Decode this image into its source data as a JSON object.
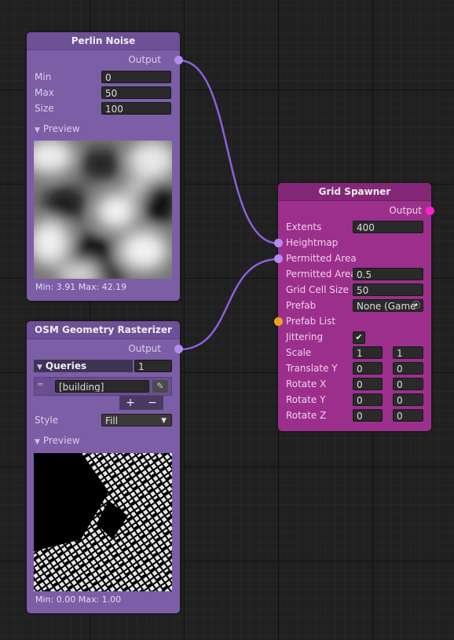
{
  "edge_color": "#8e5fd9",
  "perlin": {
    "title": "Perlin Noise",
    "output_label": "Output",
    "fields": [
      {
        "label": "Min",
        "value": "0"
      },
      {
        "label": "Max",
        "value": "50"
      },
      {
        "label": "Size",
        "value": "100"
      }
    ],
    "preview_label": "Preview",
    "minmax": "Min: 3.91 Max: 42.19"
  },
  "osm": {
    "title": "OSM Geometry Rasterizer",
    "output_label": "Output",
    "queries_label": "Queries",
    "queries_count": "1",
    "query_item": "[building]",
    "add_label": "+",
    "remove_label": "−",
    "style_label": "Style",
    "style_value": "Fill",
    "preview_label": "Preview",
    "minmax": "Min: 0.00 Max: 1.00"
  },
  "grid": {
    "title": "Grid Spawner",
    "output_label": "Output",
    "extents_label": "Extents",
    "extents_value": "400",
    "heightmap_label": "Heightmap",
    "permitted_area_input_label": "Permitted Area",
    "permitted_area_label": "Permitted Area",
    "permitted_area_value": "0.5",
    "grid_cell_size_label": "Grid Cell Size",
    "grid_cell_size_value": "50",
    "prefab_label": "Prefab",
    "prefab_value": "None (Game",
    "prefab_list_label": "Prefab List",
    "jittering_label": "Jittering",
    "jittering_check": "✔",
    "scale_label": "Scale",
    "scale_values": [
      "1",
      "1"
    ],
    "translate_y_label": "Translate Y",
    "translate_y_values": [
      "0",
      "0"
    ],
    "rotate_x_label": "Rotate X",
    "rotate_x_values": [
      "0",
      "0"
    ],
    "rotate_y_label": "Rotate Y",
    "rotate_y_values": [
      "0",
      "0"
    ],
    "rotate_z_label": "Rotate Z",
    "rotate_z_values": [
      "0",
      "0"
    ]
  }
}
